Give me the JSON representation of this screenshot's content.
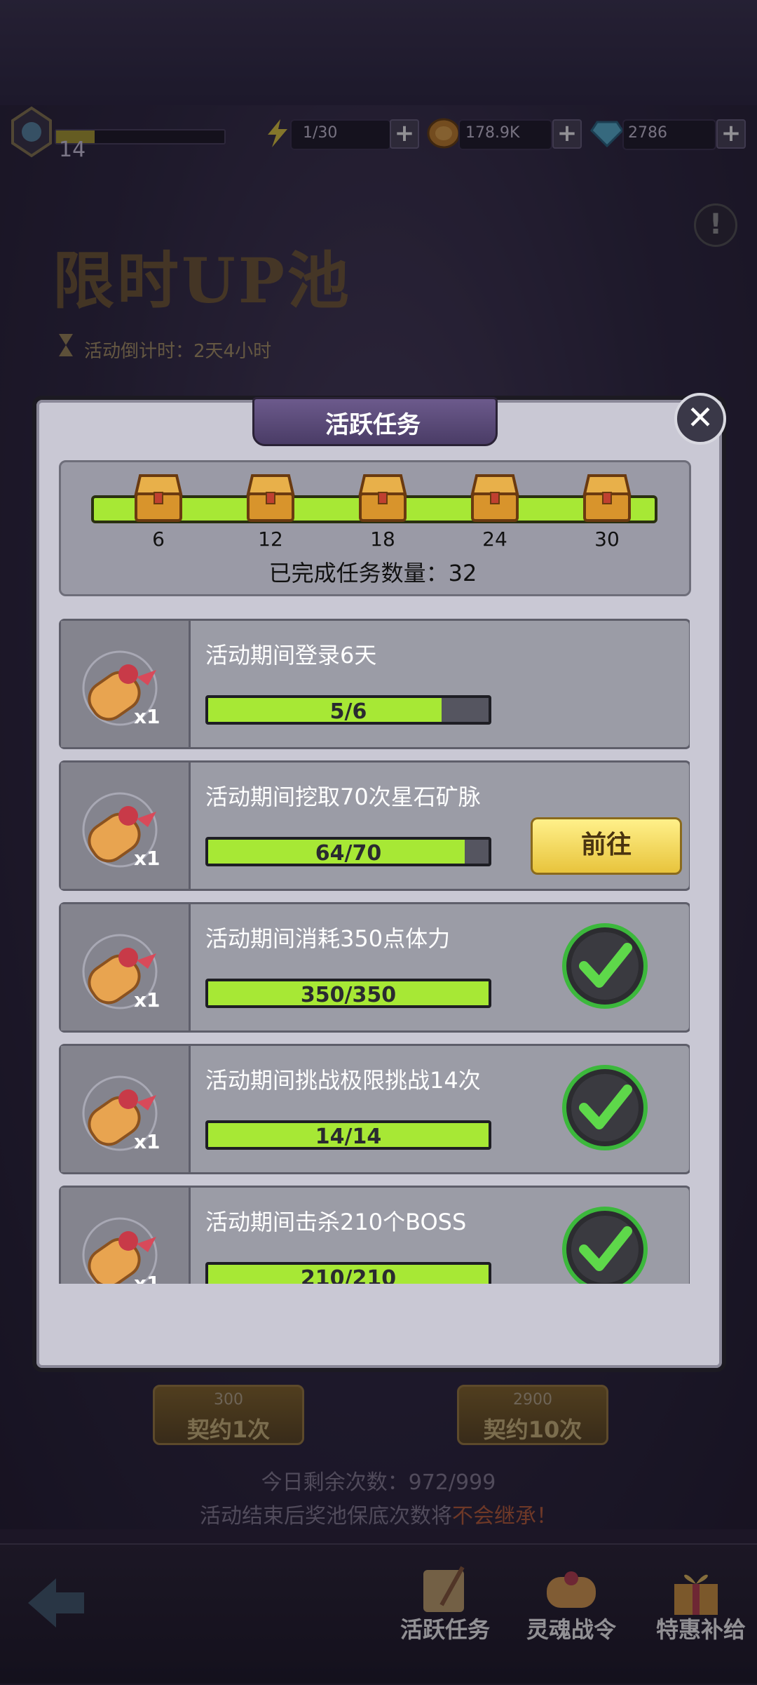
{
  "hud": {
    "level": "14",
    "stamina": "1/30",
    "coins": "178.9K",
    "gems": "2786"
  },
  "banner": {
    "title": "限时UP池",
    "timer": "活动倒计时：2天4小时"
  },
  "dialog": {
    "title": "活跃任务",
    "milestones": [
      "6",
      "12",
      "18",
      "24",
      "30"
    ],
    "completed_label": "已完成任务数量：32",
    "go_label": "前往",
    "tasks": [
      {
        "title": "活动期间登录6天",
        "progress_text": "5/6",
        "progress": 0.833,
        "qty": "x1",
        "state": "in-progress"
      },
      {
        "title": "活动期间挖取70次星石矿脉",
        "progress_text": "64/70",
        "progress": 0.914,
        "qty": "x1",
        "state": "go"
      },
      {
        "title": "活动期间消耗350点体力",
        "progress_text": "350/350",
        "progress": 1.0,
        "qty": "x1",
        "state": "done"
      },
      {
        "title": "活动期间挑战极限挑战14次",
        "progress_text": "14/14",
        "progress": 1.0,
        "qty": "x1",
        "state": "done"
      },
      {
        "title": "活动期间击杀210个BOSS",
        "progress_text": "210/210",
        "progress": 1.0,
        "qty": "x1",
        "state": "done"
      }
    ]
  },
  "summon": {
    "single": {
      "cost": "300",
      "label": "契约1次"
    },
    "ten": {
      "cost": "2900",
      "label": "契约10次"
    },
    "today_count": "今日剩余次数：972/999",
    "notice_prefix": "活动结束后奖池保底次数将",
    "notice_highlight": "不会继承！"
  },
  "nav": {
    "tasks": "活跃任务",
    "soul_pass": "灵魂战令",
    "special_offer": "特惠补给"
  },
  "colors": {
    "progress_green": "#a7e835",
    "dialog_bg": "#c9c8d4",
    "tab_purple": "#5a4a7a",
    "go_button": "#f4d85a",
    "check_green": "#3cb83c"
  }
}
